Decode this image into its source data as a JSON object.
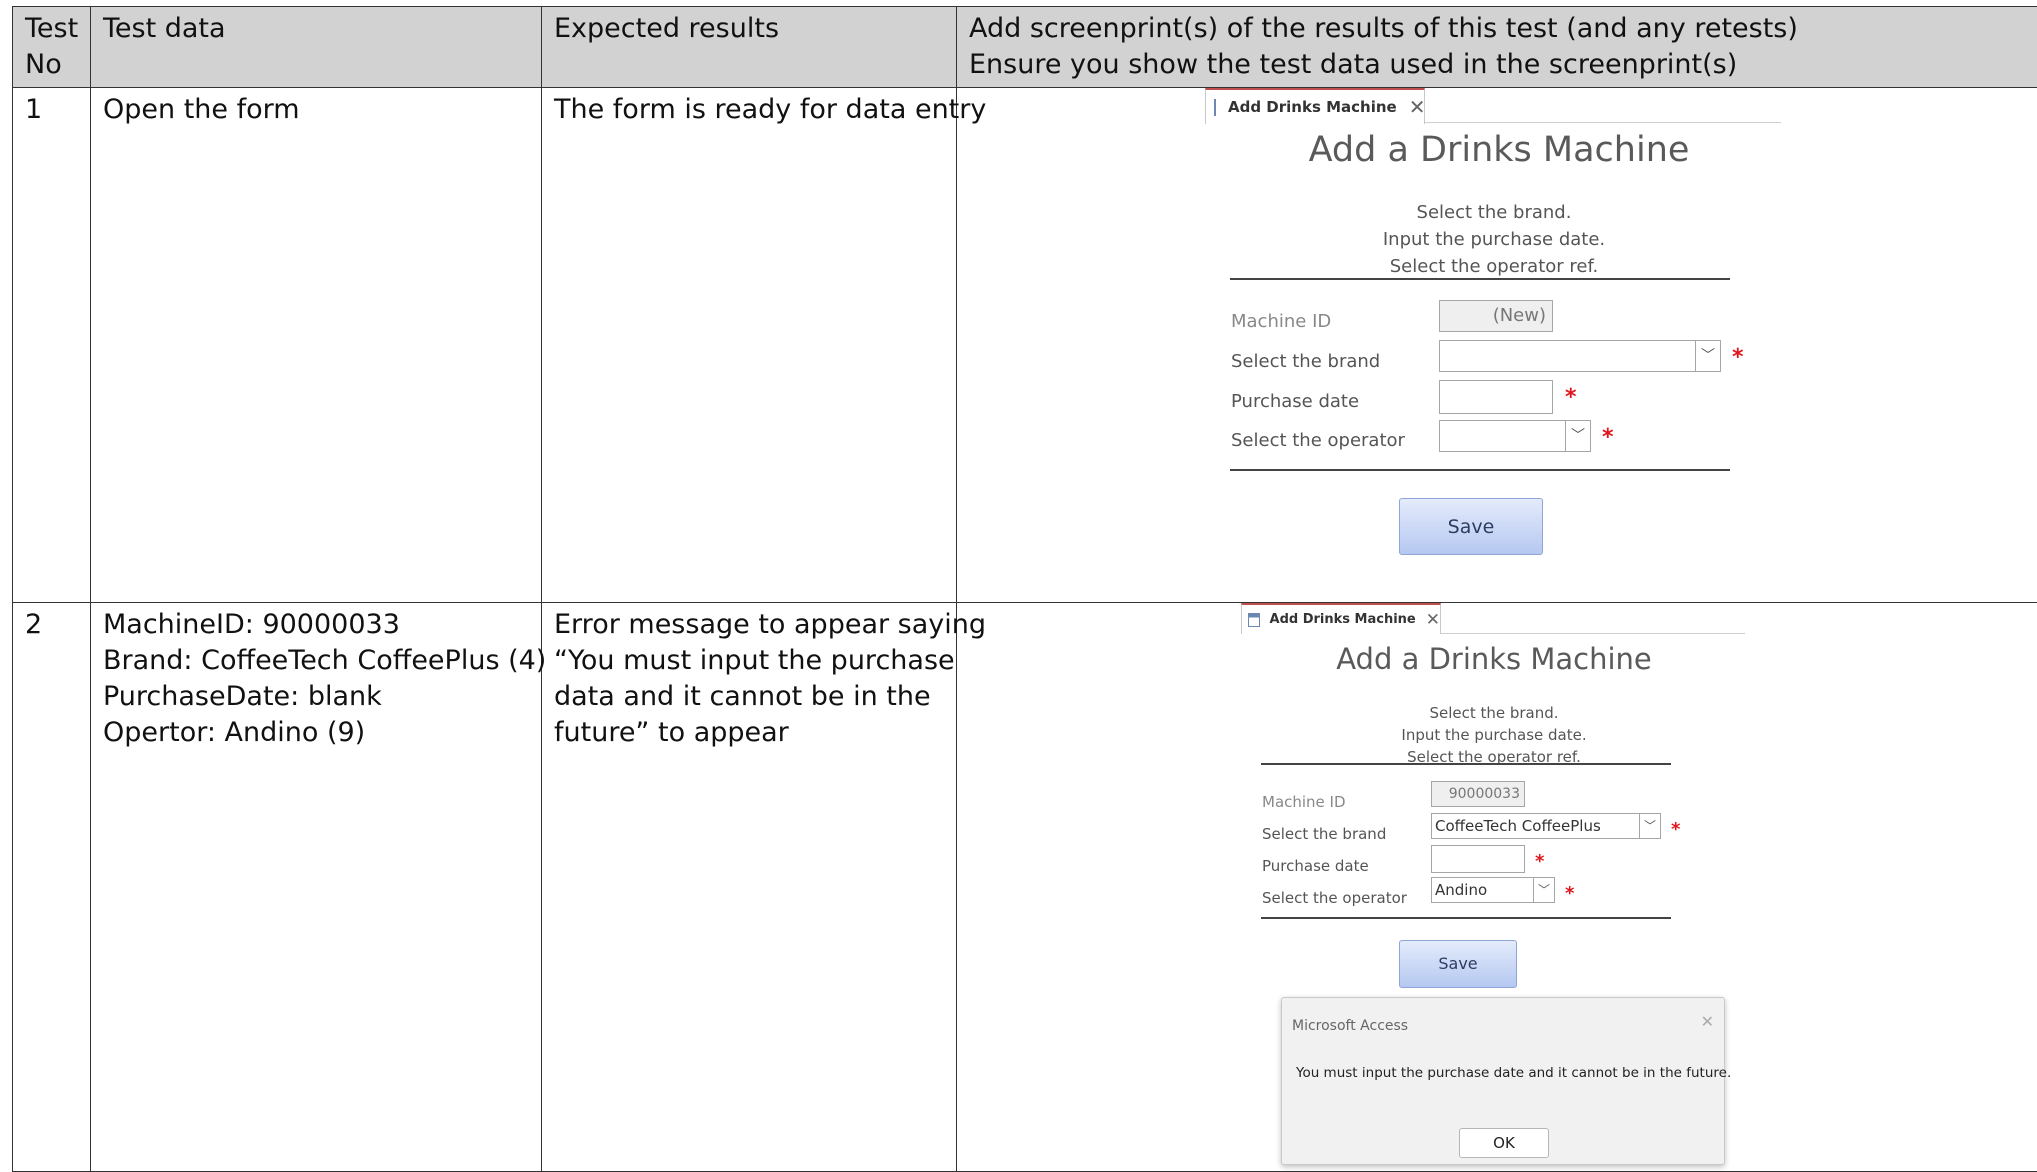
{
  "table": {
    "headers": {
      "test_no": [
        "Test",
        "No"
      ],
      "test_data": "Test data",
      "expected": "Expected results",
      "screenprint": [
        "Add screenprint(s) of the results of this test (and any retests)",
        "Ensure you show the test data used in the screenprint(s)"
      ]
    },
    "rows": [
      {
        "no": "1",
        "data_lines": [
          "Open the form"
        ],
        "expected_lines": [
          "The form is ready for data entry"
        ]
      },
      {
        "no": "2",
        "data_lines": [
          "MachineID: 90000033",
          "Brand: CoffeeTech CoffeePlus (4)",
          "PurchaseDate: blank",
          "Opertor: Andino (9)"
        ],
        "expected_lines": [
          "Error message to appear saying",
          "“You must input the purchase",
          "data and it cannot be in the",
          "future” to appear"
        ]
      }
    ]
  },
  "form1": {
    "tab_label": "Add Drinks Machine",
    "title": "Add a Drinks Machine",
    "instructions": [
      "Select the brand.",
      "Input the purchase date.",
      "Select the operator ref."
    ],
    "labels": {
      "machine_id": "Machine ID",
      "brand": "Select the brand",
      "purchase_date": "Purchase date",
      "operator": "Select the operator"
    },
    "values": {
      "machine_id": "(New)",
      "brand": "",
      "purchase_date": "",
      "operator": ""
    },
    "required_marker": "*",
    "save_label": "Save"
  },
  "form2": {
    "tab_label": "Add Drinks Machine",
    "title": "Add a Drinks Machine",
    "instructions": [
      "Select the brand.",
      "Input the purchase date.",
      "Select the operator ref."
    ],
    "labels": {
      "machine_id": "Machine ID",
      "brand": "Select the brand",
      "purchase_date": "Purchase date",
      "operator": "Select the operator"
    },
    "values": {
      "machine_id": "90000033",
      "brand": "CoffeeTech CoffeePlus",
      "purchase_date": "",
      "operator": "Andino"
    },
    "required_marker": "*",
    "save_label": "Save",
    "dialog": {
      "title": "Microsoft Access",
      "message": "You must input the purchase date and it cannot be in the future.",
      "ok_label": "OK"
    }
  },
  "icons": {
    "form_tab": "form-icon",
    "close": "close-icon",
    "dropdown": "chevron-down-icon",
    "dialog_close": "close-icon"
  },
  "colors": {
    "header_bg": "#d3d2d3",
    "required": "#e0161d",
    "tab_accent": "#c0504d",
    "save_button": "#b6c8f1"
  }
}
